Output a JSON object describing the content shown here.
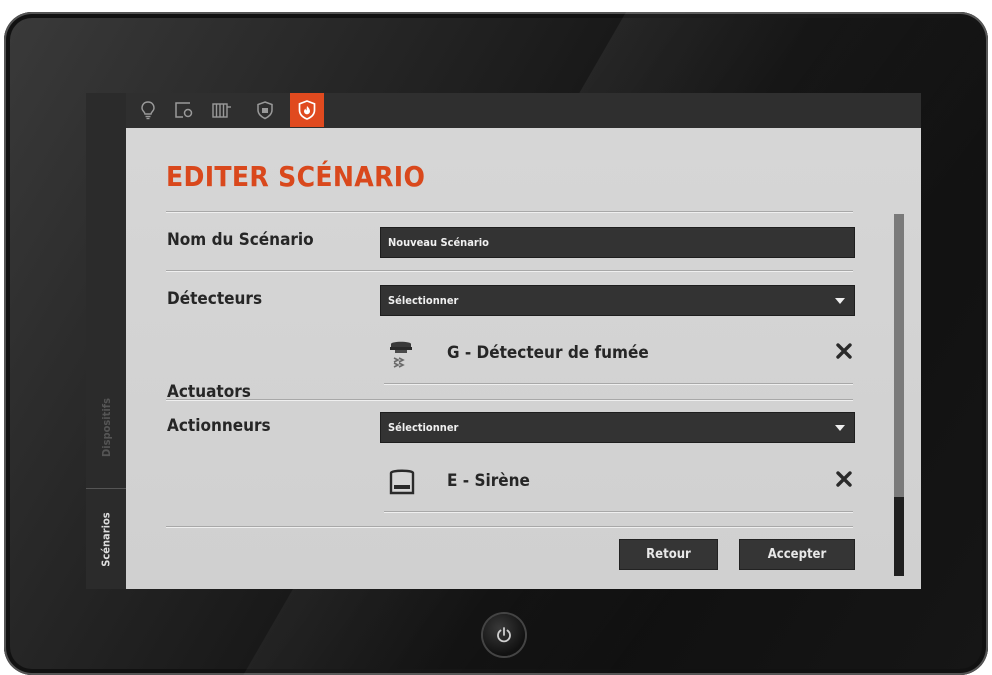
{
  "sidebar": {
    "tabs": [
      {
        "label": "Dispositifs",
        "active": false
      },
      {
        "label": "Scénarios",
        "active": true
      }
    ]
  },
  "topbar": {
    "icons": [
      "bulb-icon",
      "window-sensor-icon",
      "radiator-icon",
      "shield-icon",
      "fire-shield-icon"
    ],
    "active_icon": "fire-shield-icon",
    "accent_color": "#e04a1f"
  },
  "form": {
    "title": "EDITER SCÉNARIO",
    "name_label": "Nom du Scénario",
    "name_value": "Nouveau Scénario",
    "detectors_label": "Détecteurs",
    "detectors_select": "Sélectionner",
    "detector_items": [
      {
        "name": "G - Détecteur de fumée",
        "icon": "smoke-detector-icon"
      }
    ],
    "actuators_heading": "Actuators",
    "actuators_label": "Actionneurs",
    "actuators_select": "Sélectionner",
    "actuator_items": [
      {
        "name": "E - Sirène",
        "icon": "siren-icon"
      }
    ]
  },
  "buttons": {
    "back": "Retour",
    "accept": "Accepter"
  }
}
